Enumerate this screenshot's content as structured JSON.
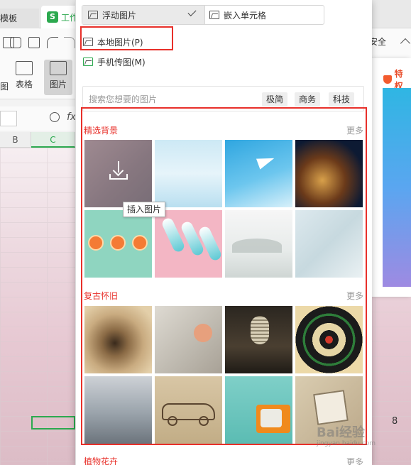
{
  "background_app": {
    "tab_template": "模板",
    "tab_workbook": "工作",
    "ribbon_table": "表格",
    "ribbon_image": "图片",
    "ribbon_image_prefix": "图",
    "fx": "fx",
    "col_b": "B",
    "col_c": "C",
    "right_tab": "安全",
    "side_card_title": "特权",
    "page_number": "8"
  },
  "insert_mode": {
    "float_label": "浮动图片",
    "embed_label": "嵌入单元格",
    "selected": "float"
  },
  "menu": {
    "local_image": "本地图片(P)",
    "phone_image": "手机传图(M)"
  },
  "search": {
    "placeholder": "搜索您想要的图片",
    "tags": [
      "极简",
      "商务",
      "科技"
    ]
  },
  "sections": [
    {
      "title": "精选背景",
      "more": "更多",
      "images": [
        "faded-pink-mauve",
        "light-sky-clouds",
        "paper-plane-blue",
        "circuit-gold-dark",
        "orange-slices-mint",
        "popsicles-pink",
        "ink-landscape-white",
        "soft-leaves-pale"
      ]
    },
    {
      "title": "复古怀旧",
      "more": "更多",
      "images": [
        "vintage-tunnel",
        "pinwheel-grey",
        "retro-microphone",
        "dartboard",
        "rainy-window",
        "vintage-car-sketch",
        "retro-tv-teal",
        "vintage-photos"
      ]
    },
    {
      "title": "植物花卉",
      "more": "更多"
    }
  ],
  "tooltip": "插入图片",
  "watermark": "Bai经验",
  "watermark_sub": "jingyan.baidu.com",
  "colors": {
    "highlight_red": "#e8302a",
    "wps_green": "#2ca94f"
  }
}
